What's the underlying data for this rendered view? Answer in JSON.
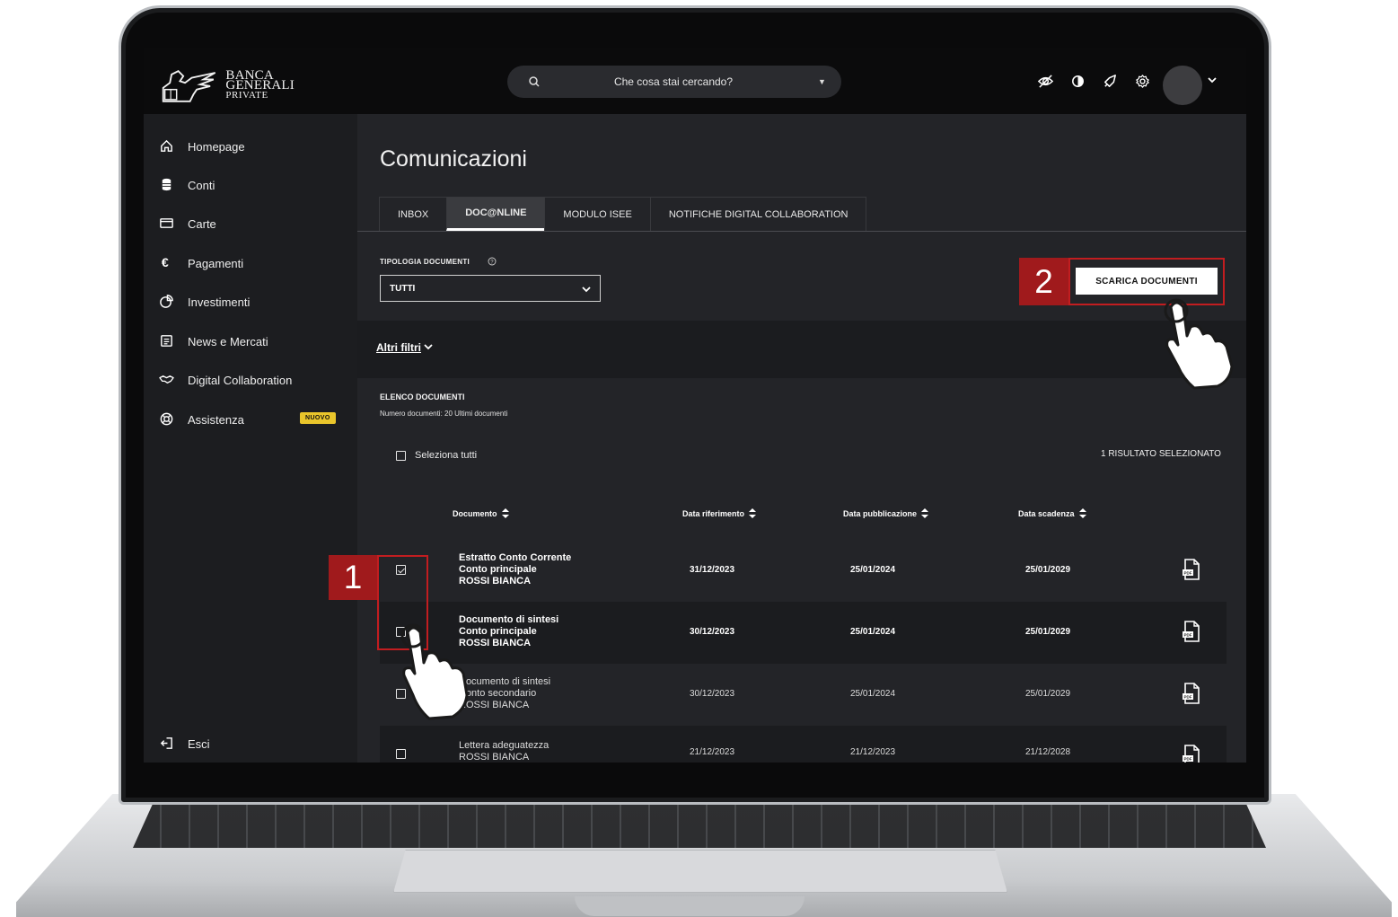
{
  "brand": {
    "line1": "BANCA",
    "line2": "GENERALI",
    "line3": "PRIVATE"
  },
  "search": {
    "placeholder": "Che cosa stai cercando?"
  },
  "header_icons": [
    "eye-off-icon",
    "contrast-icon",
    "rocket-icon",
    "gear-icon"
  ],
  "sidebar": {
    "items": [
      {
        "label": "Homepage",
        "icon": "home-icon"
      },
      {
        "label": "Conti",
        "icon": "database-icon"
      },
      {
        "label": "Carte",
        "icon": "card-icon"
      },
      {
        "label": "Pagamenti",
        "icon": "euro-icon"
      },
      {
        "label": "Investimenti",
        "icon": "pie-chart-icon"
      },
      {
        "label": "News e Mercati",
        "icon": "newspaper-icon"
      },
      {
        "label": "Digital Collaboration",
        "icon": "handshake-icon"
      },
      {
        "label": "Assistenza",
        "icon": "lifebuoy-icon",
        "badge": "NUOVO"
      }
    ],
    "logout": "Esci"
  },
  "main": {
    "title": "Comunicazioni",
    "tabs": [
      {
        "label": "INBOX"
      },
      {
        "label": "DOC@NLINE",
        "active": true
      },
      {
        "label": "MODULO ISEE"
      },
      {
        "label": "NOTIFICHE DIGITAL COLLABORATION"
      }
    ],
    "filter_label": "TIPOLOGIA DOCUMENTI",
    "filter_value": "TUTTI",
    "download_label": "SCARICA DOCUMENTI",
    "more_filters": "Altri filtri",
    "list_title": "ELENCO DOCUMENTI",
    "list_subtitle": "Numero documenti: 20 Ultimi documenti",
    "select_all": "Seleziona tutti",
    "selected_count": "1 RISULTATO SELEZIONATO",
    "columns": [
      "Documento",
      "Data riferimento",
      "Data pubblicazione",
      "Data scadenza"
    ],
    "rows": [
      {
        "line1": "Estratto Conto Corrente",
        "line2": "Conto principale",
        "line3": "ROSSI BIANCA",
        "data_riferimento": "31/12/2023",
        "data_pubblicazione": "25/01/2024",
        "data_scadenza": "25/01/2029",
        "checked": true
      },
      {
        "line1": "Documento di sintesi",
        "line2": "Conto principale",
        "line3": "ROSSI BIANCA",
        "data_riferimento": "30/12/2023",
        "data_pubblicazione": "25/01/2024",
        "data_scadenza": "25/01/2029",
        "checked": false
      },
      {
        "line1": "Documento di sintesi",
        "line2": "Conto secondario",
        "line3": "ROSSI BIANCA",
        "data_riferimento": "30/12/2023",
        "data_pubblicazione": "25/01/2024",
        "data_scadenza": "25/01/2029",
        "checked": false
      },
      {
        "line1": "Lettera adeguatezza",
        "line2": "ROSSI BIANCA",
        "line3": "",
        "data_riferimento": "21/12/2023",
        "data_pubblicazione": "21/12/2023",
        "data_scadenza": "21/12/2028",
        "checked": false
      }
    ]
  },
  "annotations": {
    "step1": "1",
    "step2": "2"
  },
  "colors": {
    "accent_red": "#a01a1c",
    "badge_yellow": "#e9c52b",
    "screen_bg": "#232428"
  }
}
